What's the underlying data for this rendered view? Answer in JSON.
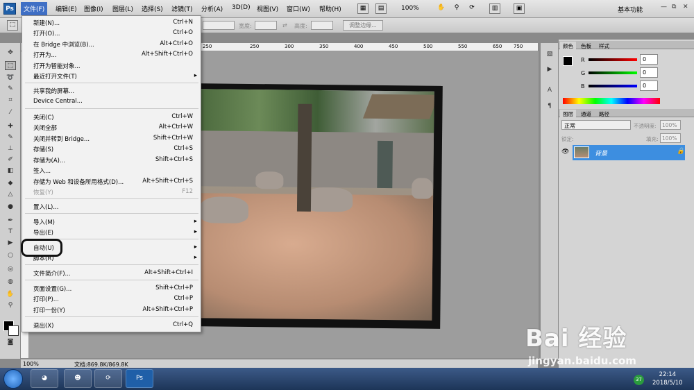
{
  "menubar": {
    "logo": "Ps",
    "items": [
      "文件(F)",
      "编辑(E)",
      "图像(I)",
      "图层(L)",
      "选择(S)",
      "滤镜(T)",
      "分析(A)",
      "3D(D)",
      "视图(V)",
      "窗口(W)",
      "帮助(H)"
    ],
    "zoom": "100%",
    "workspace": "基本功能",
    "window_buttons": [
      "—",
      "⧉",
      "✕"
    ]
  },
  "options": {
    "width_label": "宽度:",
    "height_label": "高度:",
    "refine_button": "调整边缘..."
  },
  "ruler": [
    "250",
    "200",
    "250",
    "300",
    "350",
    "400",
    "450",
    "500",
    "550",
    "600",
    "650",
    "700",
    "750"
  ],
  "status": {
    "zoom": "100%",
    "doc": "文档:869.8K/869.8K"
  },
  "file_menu": {
    "items": [
      {
        "label": "新建(N)...",
        "shortcut": "Ctrl+N"
      },
      {
        "label": "打开(O)...",
        "shortcut": "Ctrl+O"
      },
      {
        "label": "在 Bridge 中浏览(B)...",
        "shortcut": "Alt+Ctrl+O"
      },
      {
        "label": "打开为...",
        "shortcut": "Alt+Shift+Ctrl+O"
      },
      {
        "label": "打开为智能对象..."
      },
      {
        "label": "最近打开文件(T)",
        "arrow": "▸"
      },
      {
        "label": "共享我的屏幕..."
      },
      {
        "label": "Device Central..."
      },
      {
        "label": "关闭(C)",
        "shortcut": "Ctrl+W"
      },
      {
        "label": "关闭全部",
        "shortcut": "Alt+Ctrl+W"
      },
      {
        "label": "关闭并转到 Bridge...",
        "shortcut": "Shift+Ctrl+W"
      },
      {
        "label": "存储(S)",
        "shortcut": "Ctrl+S"
      },
      {
        "label": "存储为(A)...",
        "shortcut": "Shift+Ctrl+S"
      },
      {
        "label": "签入..."
      },
      {
        "label": "存储为 Web 和设备所用格式(D)...",
        "shortcut": "Alt+Shift+Ctrl+S"
      },
      {
        "label": "恢复(Y)",
        "shortcut": "F12",
        "disabled": true
      },
      {
        "label": "置入(L)..."
      },
      {
        "label": "导入(M)",
        "arrow": "▸"
      },
      {
        "label": "导出(E)",
        "arrow": "▸"
      },
      {
        "label": "自动(U)",
        "arrow": "▸"
      },
      {
        "label": "脚本(R)",
        "arrow": "▸"
      },
      {
        "label": "文件简介(F)...",
        "shortcut": "Alt+Shift+Ctrl+I"
      },
      {
        "label": "页面设置(G)...",
        "shortcut": "Shift+Ctrl+P"
      },
      {
        "label": "打印(P)...",
        "shortcut": "Ctrl+P"
      },
      {
        "label": "打印一份(Y)",
        "shortcut": "Alt+Shift+Ctrl+P"
      },
      {
        "label": "退出(X)",
        "shortcut": "Ctrl+Q"
      }
    ]
  },
  "panels": {
    "color_tabs": [
      "颜色",
      "色板",
      "样式"
    ],
    "color_channels": [
      {
        "name": "R",
        "value": "0"
      },
      {
        "name": "G",
        "value": "0"
      },
      {
        "name": "B",
        "value": "0"
      }
    ],
    "layer_tabs": [
      "图层",
      "通道",
      "路径"
    ],
    "blend_mode": "正常",
    "opacity_label": "不透明度:",
    "opacity": "100%",
    "lock_label": "锁定:",
    "fill_label": "填充:",
    "fill": "100%",
    "layer_name": "背景"
  },
  "taskbar": {
    "time": "22:14",
    "date": "2018/5/10",
    "badge": "37",
    "active_app": "Ps"
  },
  "watermark": {
    "main": "Bai 经验",
    "sub": "jingyan.baidu.com"
  },
  "colors": {
    "menu_highlight": "#3f6fc5",
    "layer_selected": "#3d8ee0"
  }
}
